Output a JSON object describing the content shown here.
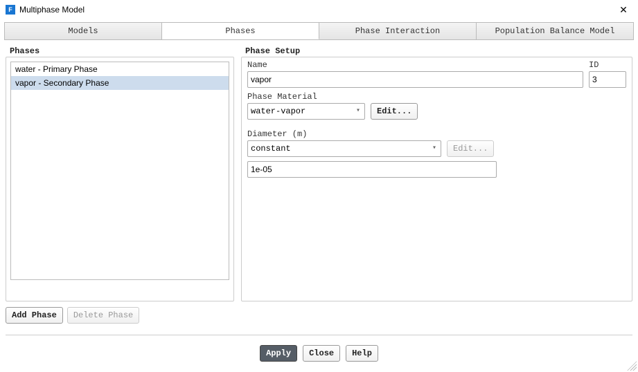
{
  "window": {
    "title": "Multiphase Model",
    "icon_letter": "F"
  },
  "tabs": {
    "models": "Models",
    "phases": "Phases",
    "interaction": "Phase Interaction",
    "population": "Population Balance Model"
  },
  "left": {
    "header": "Phases",
    "items": [
      {
        "label": "water - Primary Phase"
      },
      {
        "label": "vapor - Secondary Phase"
      }
    ],
    "add_button": "Add Phase",
    "delete_button": "Delete Phase"
  },
  "right": {
    "header": "Phase Setup",
    "name_label": "Name",
    "name_value": "vapor",
    "id_label": "ID",
    "id_value": "3",
    "material_label": "Phase Material",
    "material_value": "water-vapor",
    "edit1": "Edit...",
    "diameter_label": "Diameter (m)",
    "diameter_type": "constant",
    "edit2": "Edit...",
    "diameter_value": "1e-05"
  },
  "footer": {
    "apply": "Apply",
    "close": "Close",
    "help": "Help"
  }
}
